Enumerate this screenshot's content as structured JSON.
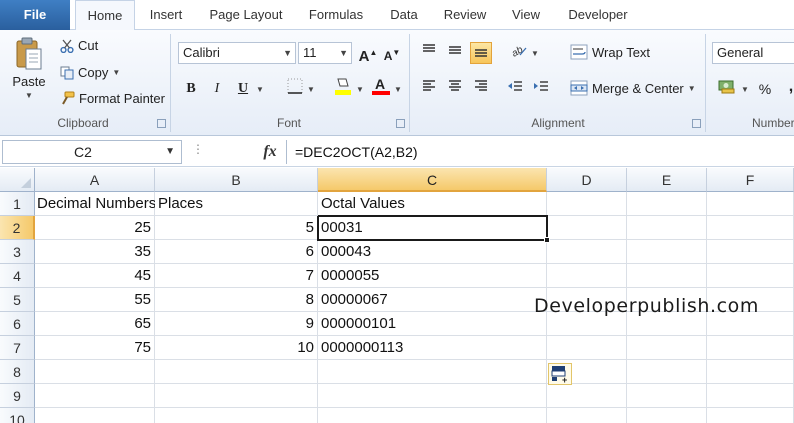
{
  "tabs": [
    "File",
    "Home",
    "Insert",
    "Page Layout",
    "Formulas",
    "Data",
    "Review",
    "View",
    "Developer"
  ],
  "clipboard": {
    "paste": "Paste",
    "cut": "Cut",
    "copy": "Copy",
    "format_painter": "Format Painter",
    "group": "Clipboard"
  },
  "font": {
    "name": "Calibri",
    "size": "11",
    "bold": "B",
    "italic": "I",
    "underline": "U",
    "grow": "A",
    "shrink": "A",
    "group": "Font",
    "fill_color": "#ffff00",
    "font_color": "#ff0000"
  },
  "alignment": {
    "wrap_text": "Wrap Text",
    "merge_center": "Merge & Center",
    "group": "Alignment"
  },
  "number": {
    "format": "General",
    "percent": "%",
    "comma": ",",
    "group": "Number"
  },
  "formula_bar": {
    "name_box": "C2",
    "fx": "fx",
    "formula": "=DEC2OCT(A2,B2)"
  },
  "columns": [
    "A",
    "B",
    "C",
    "D",
    "E",
    "F"
  ],
  "rows": [
    "1",
    "2",
    "3",
    "4",
    "5",
    "6",
    "7",
    "8",
    "9",
    "10"
  ],
  "headers": {
    "a": "Decimal Numbers",
    "b": "Places",
    "c": "Octal Values"
  },
  "data_rows": [
    {
      "a": "25",
      "b": "5",
      "c": "00031"
    },
    {
      "a": "35",
      "b": "6",
      "c": "000043"
    },
    {
      "a": "45",
      "b": "7",
      "c": "0000055"
    },
    {
      "a": "55",
      "b": "8",
      "c": "00000067"
    },
    {
      "a": "65",
      "b": "9",
      "c": "000000101"
    },
    {
      "a": "75",
      "b": "10",
      "c": "0000000113"
    }
  ],
  "watermark": "Developerpublish.com",
  "colors": {
    "selected_header": "#f5c96a",
    "file_tab": "#2a5f9e"
  }
}
